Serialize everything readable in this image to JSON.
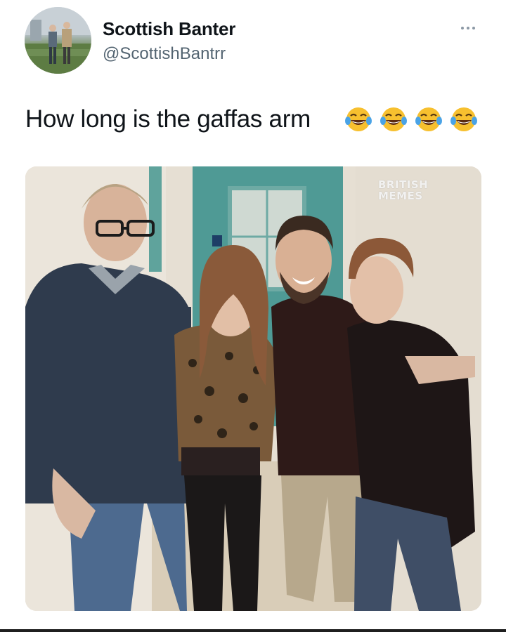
{
  "tweet": {
    "author": {
      "name": "Scottish Banter",
      "handle": "@ScottishBantrr",
      "avatar_icon": "avatar-photo"
    },
    "more_icon": "more-options-icon",
    "text": "How long is the gaffas arm",
    "emojis": [
      "face-with-tears-of-joy",
      "face-with-tears-of-joy",
      "face-with-tears-of-joy",
      "face-with-tears-of-joy"
    ],
    "media": {
      "watermark_line1": "BRITISH",
      "watermark_line2": "MEMES"
    }
  },
  "colors": {
    "text": "#0f1419",
    "secondary_text": "#536471",
    "door": "#4f9a95",
    "wall": "#e8e2d8"
  }
}
